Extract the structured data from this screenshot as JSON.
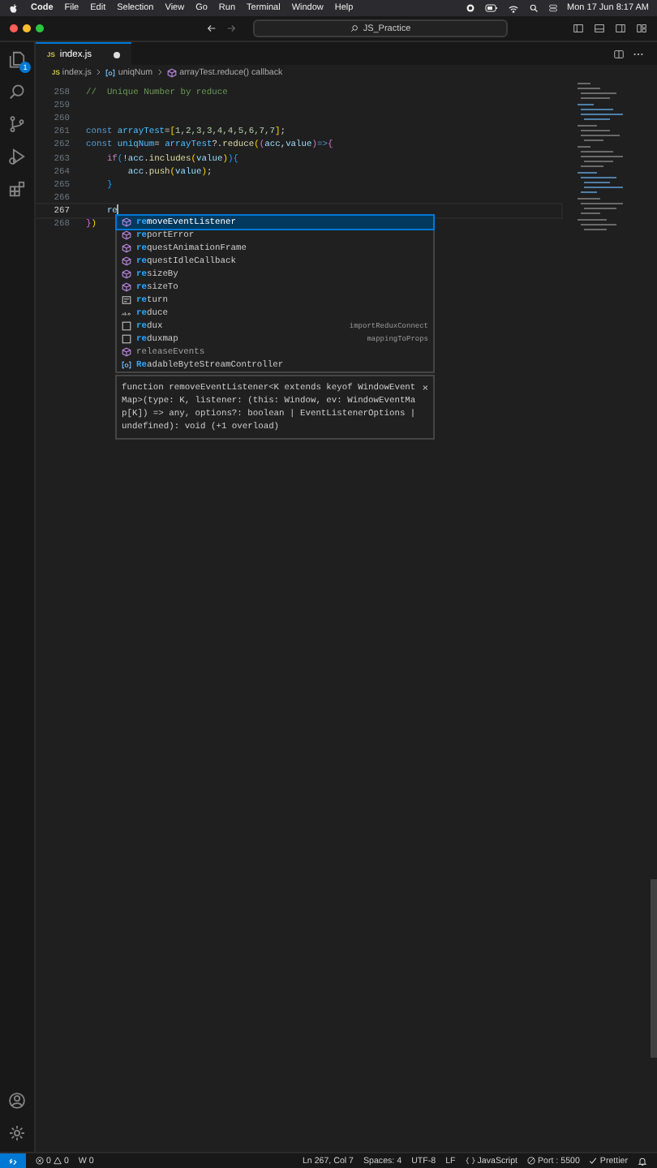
{
  "menu_bar": {
    "app": "Code",
    "items": [
      "File",
      "Edit",
      "Selection",
      "View",
      "Go",
      "Run",
      "Terminal",
      "Window",
      "Help"
    ],
    "clock": "Mon 17 Jun  8:17 AM"
  },
  "title_bar": {
    "search": "JS_Practice"
  },
  "activity_bar": {
    "explorer_badge": "1"
  },
  "tabs": [
    {
      "label": "index.js",
      "file_icon": "JS",
      "modified": true,
      "selected": true
    }
  ],
  "breadcrumb": [
    {
      "label": "index.js",
      "kind": "file",
      "icon_text": "JS"
    },
    {
      "label": "uniqNum",
      "kind": "variable"
    },
    {
      "label": "arrayTest.reduce() callback",
      "kind": "method"
    }
  ],
  "editor": {
    "lines": [
      {
        "number": "258",
        "current": false,
        "tokens": [
          {
            "text": "//  Unique Number by reduce",
            "kind": "comment"
          }
        ]
      },
      {
        "number": "259",
        "current": false
      },
      {
        "number": "260",
        "current": false
      },
      {
        "number": "261",
        "current": false,
        "tokens": [
          {
            "text": "const ",
            "kind": "keyword"
          },
          {
            "text": "arrayTest",
            "kind": "constant"
          },
          {
            "text": "=",
            "kind": "punctuation"
          },
          {
            "text": "[",
            "kind": "bracket1"
          },
          {
            "text": "1,2,3,3,4,4,5,6,7,7",
            "kind": "number"
          },
          {
            "text": "]",
            "kind": "bracket1"
          },
          {
            "text": ";",
            "kind": "punctuation"
          }
        ]
      },
      {
        "number": "262",
        "current": false,
        "tokens": [
          {
            "text": "const ",
            "kind": "keyword"
          },
          {
            "text": "uniqNum",
            "kind": "constant"
          },
          {
            "text": "= ",
            "kind": "punctuation"
          },
          {
            "text": "arrayTest",
            "kind": "constant"
          },
          {
            "text": "?.",
            "kind": "punctuation"
          },
          {
            "text": "reduce",
            "kind": "function"
          },
          {
            "text": "(",
            "kind": "bracket1"
          },
          {
            "text": "(",
            "kind": "bracket2"
          },
          {
            "text": "acc",
            "kind": "variable"
          },
          {
            "text": ",",
            "kind": "punctuation"
          },
          {
            "text": "value",
            "kind": "variable"
          },
          {
            "text": ")",
            "kind": "bracket2"
          },
          {
            "text": "=>",
            "kind": "keyword"
          },
          {
            "text": "{",
            "kind": "bracket2"
          }
        ]
      },
      {
        "number": "263",
        "current": false,
        "tokens": [
          {
            "text": "    if",
            "kind": "control"
          },
          {
            "text": "(",
            "kind": "bracket3"
          },
          {
            "text": "!",
            "kind": "punctuation"
          },
          {
            "text": "acc",
            "kind": "variable"
          },
          {
            "text": ".",
            "kind": "punctuation"
          },
          {
            "text": "includes",
            "kind": "function"
          },
          {
            "text": "(",
            "kind": "bracket1"
          },
          {
            "text": "value",
            "kind": "variable"
          },
          {
            "text": ")",
            "kind": "bracket1"
          },
          {
            "text": ")",
            "kind": "bracket3"
          },
          {
            "text": "{",
            "kind": "bracket3"
          }
        ]
      },
      {
        "number": "264",
        "current": false,
        "tokens": [
          {
            "text": "        acc",
            "kind": "variable"
          },
          {
            "text": ".",
            "kind": "punctuation"
          },
          {
            "text": "push",
            "kind": "function"
          },
          {
            "text": "(",
            "kind": "bracket1"
          },
          {
            "text": "value",
            "kind": "variable"
          },
          {
            "text": ")",
            "kind": "bracket1"
          },
          {
            "text": ";",
            "kind": "punctuation"
          }
        ]
      },
      {
        "number": "265",
        "current": false,
        "tokens": [
          {
            "text": "    }",
            "kind": "bracket3"
          }
        ]
      },
      {
        "number": "266",
        "current": false
      },
      {
        "number": "267",
        "current": true,
        "tokens": [
          {
            "text": "    re",
            "kind": "variable"
          }
        ]
      },
      {
        "number": "268",
        "current": false,
        "tokens": [
          {
            "text": "}",
            "kind": "bracket2"
          },
          {
            "text": ")",
            "kind": "bracket1"
          }
        ]
      }
    ]
  },
  "suggestions": [
    {
      "kind": "method",
      "label": "**re**moveEventListener",
      "selected": true,
      "deprecated": false
    },
    {
      "kind": "method",
      "label": "**re**portError",
      "selected": false,
      "deprecated": false
    },
    {
      "kind": "method",
      "label": "**re**questAnimationFrame",
      "selected": false,
      "deprecated": false
    },
    {
      "kind": "method",
      "label": "**re**questIdleCallback",
      "selected": false,
      "deprecated": false
    },
    {
      "kind": "method",
      "label": "**re**sizeBy",
      "selected": false,
      "deprecated": false
    },
    {
      "kind": "method",
      "label": "**re**sizeTo",
      "selected": false,
      "deprecated": false
    },
    {
      "kind": "keyword",
      "label": "**re**turn",
      "selected": false,
      "deprecated": false
    },
    {
      "kind": "text",
      "label": "**re**duce",
      "selected": false,
      "deprecated": false
    },
    {
      "kind": "snippet",
      "label": "**re**dux",
      "detail": "importReduxConnect",
      "selected": false,
      "deprecated": false
    },
    {
      "kind": "snippet",
      "label": "**re**duxmap",
      "detail": "mappingToProps",
      "selected": false,
      "deprecated": false
    },
    {
      "kind": "method",
      "label": "releaseEvents",
      "selected": false,
      "deprecated": true
    },
    {
      "kind": "variable",
      "label": "**Re**adableByteStreamController",
      "selected": false,
      "deprecated": false
    }
  ],
  "suggestion_doc": {
    "text": "function removeEventListener<K extends keyof WindowEventMap>(type: K, listener: (this: Window, ev: WindowEventMap[K]) => any, options?: boolean | EventListenerOptions | undefined): void (+1 overload)",
    "close": "×"
  },
  "status_bar": {
    "errors": "0",
    "warnings": "0",
    "w": "W 0",
    "items": [
      "Ln 267, Col 7",
      "Spaces: 4",
      "UTF-8",
      "LF"
    ],
    "language": "JavaScript",
    "port": "Port : 5500",
    "prettier": "Prettier"
  }
}
